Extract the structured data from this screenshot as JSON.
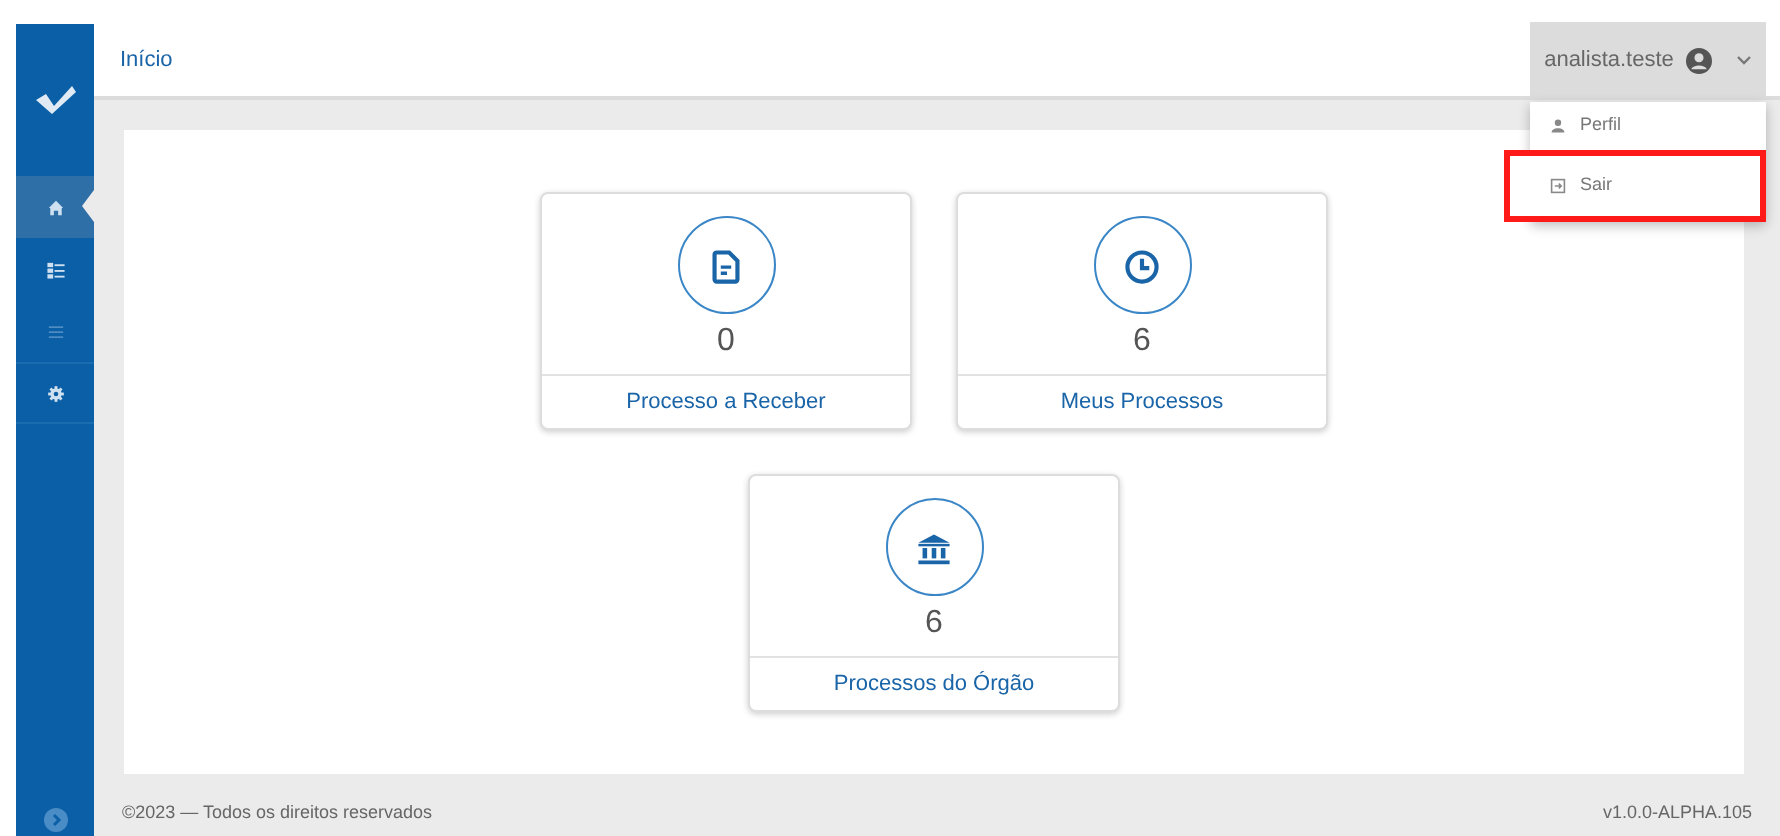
{
  "header": {
    "title": "Início",
    "user": "analista.teste"
  },
  "user_menu": {
    "expanded": true,
    "items": [
      {
        "kind": "profile",
        "label": "Perfil",
        "highlighted": false
      },
      {
        "kind": "logout",
        "label": "Sair",
        "highlighted": true
      }
    ]
  },
  "sidebar": {
    "items": [
      {
        "kind": "home",
        "selected": true,
        "disabled": false
      },
      {
        "kind": "checklist",
        "selected": false,
        "disabled": false
      },
      {
        "kind": "list",
        "selected": false,
        "disabled": true
      },
      {
        "kind": "settings",
        "selected": false,
        "disabled": false
      }
    ]
  },
  "cards": [
    {
      "kind": "document",
      "count": "0",
      "label": "Processo a Receber"
    },
    {
      "kind": "clock",
      "count": "6",
      "label": "Meus Processos"
    },
    {
      "kind": "building",
      "count": "6",
      "label": "Processos do Órgão"
    }
  ],
  "footer": {
    "copyright": "©2023 — Todos os direitos reservados",
    "version": "v1.0.0-ALPHA.105"
  }
}
